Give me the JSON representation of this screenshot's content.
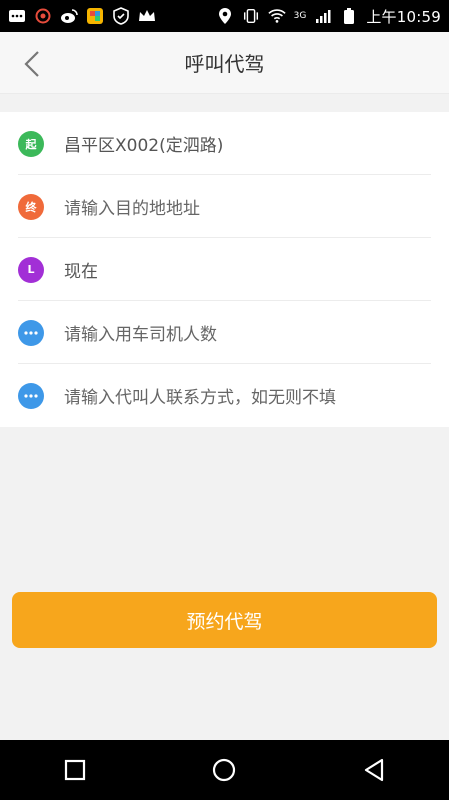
{
  "status_bar": {
    "network": "3G",
    "time": "上午10:59",
    "icons": [
      "message-icon",
      "weibo-icon",
      "gallery-icon",
      "shield-icon",
      "crown-icon",
      "location-icon",
      "vibrate-icon",
      "wifi-icon",
      "signal-icon",
      "battery-icon"
    ]
  },
  "header": {
    "title": "呼叫代驾",
    "back_icon": "chevron-left-icon"
  },
  "form": {
    "items": [
      {
        "badge": "起",
        "color": "#3cb95a",
        "text": "昌平区X002(定泗路)"
      },
      {
        "badge": "终",
        "color": "#f06a3a",
        "text": "请输入目的地地址"
      },
      {
        "badge": "L",
        "color": "#a22fd6",
        "text": "现在"
      },
      {
        "badge": "···",
        "color": "#3e98e8",
        "text": "请输入用车司机人数"
      },
      {
        "badge": "···",
        "color": "#3e98e8",
        "text": "请输入代叫人联系方式，如无则不填"
      }
    ]
  },
  "action": {
    "submit_label": "预约代驾",
    "color": "#f7a61c"
  },
  "nav_bar": {
    "icons": [
      "recent-apps-icon",
      "home-icon",
      "back-icon"
    ]
  }
}
